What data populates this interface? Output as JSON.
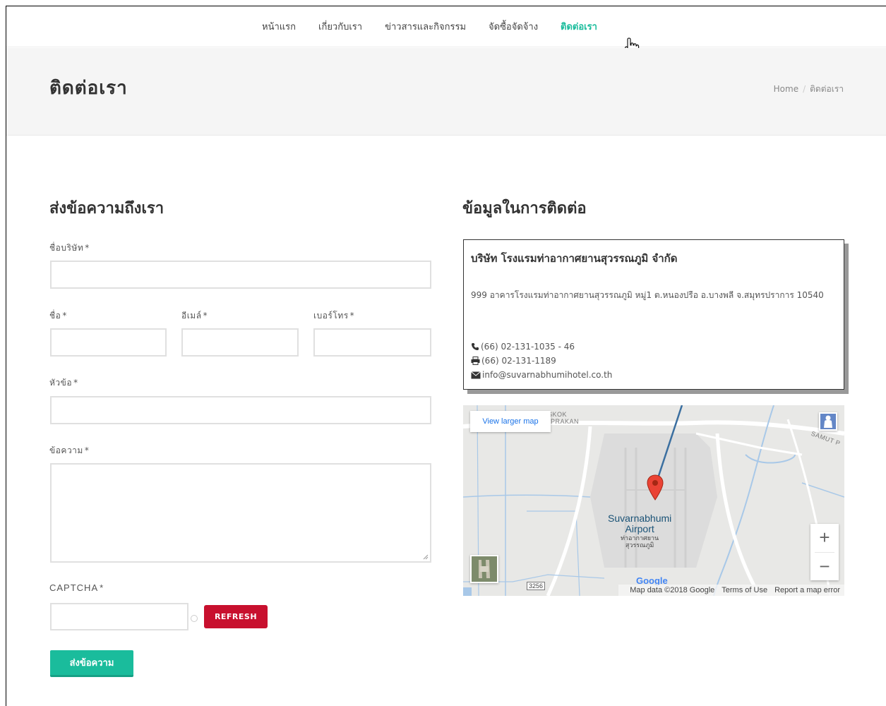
{
  "nav": {
    "items": [
      {
        "label": "หน้าแรก"
      },
      {
        "label": "เกี่ยวกับเรา"
      },
      {
        "label": "ข่าวสารและกิจกรรม"
      },
      {
        "label": "จัดซื้อจัดจ้าง"
      },
      {
        "label": "ติดต่อเรา",
        "active": true
      }
    ]
  },
  "header": {
    "title": "ติดต่อเรา",
    "breadcrumb": [
      "Home",
      "ติดต่อเรา"
    ]
  },
  "form": {
    "heading": "ส่งข้อความถึงเรา",
    "required_mark": "*",
    "company_label": "ชื่อบริษัท",
    "name_label": "ชื่อ",
    "email_label": "อีเมล์",
    "phone_label": "เบอร์โทร",
    "subject_label": "หัวข้อ",
    "message_label": "ข้อความ",
    "captcha_label": "CAPTCHA",
    "refresh_label": "REFRESH",
    "submit_label": "ส่งข้อความ",
    "company_value": "",
    "name_value": "",
    "email_value": "",
    "phone_value": "",
    "subject_value": "",
    "message_value": "",
    "captcha_value": ""
  },
  "contact": {
    "heading": "ข้อมูลในการติดต่อ",
    "company": "บริษัท โรงแรมท่าอากาศยานสุวรรณภูมิ จำกัด",
    "address": "999 อาคารโรงแรมท่าอากาศยานสุวรรณภูมิ หมู่1 ต.หนองปรือ อ.บางพลี จ.สมุทรปราการ 10540",
    "phone": "(66) 02-131-1035 - 46",
    "fax": "(66) 02-131-1189",
    "email": "info@suvarnabhumihotel.co.th",
    "phone_icon": "phone-icon",
    "fax_icon": "fax-icon",
    "email_icon": "envelope-icon"
  },
  "map": {
    "view_larger": "View larger map",
    "airport_name": "Suvarnabhumi",
    "airport_name2": "Airport",
    "airport_thai": "ท่าอากาศยาน",
    "airport_thai2": "สุวรรณภูมิ",
    "label_bangkok": "SKOK",
    "label_prakan": "PRAKAN",
    "label_samut": "SAMUT P",
    "road_shield": "3256",
    "google_logo": "Google",
    "map_data": "Map data ©2018 Google",
    "terms": "Terms of Use",
    "report": "Report a map error",
    "zoom_in": "+",
    "zoom_out": "−"
  },
  "colors": {
    "accent": "#1abc9c",
    "refresh_button": "#c8102e",
    "map_link": "#1a73e8"
  }
}
